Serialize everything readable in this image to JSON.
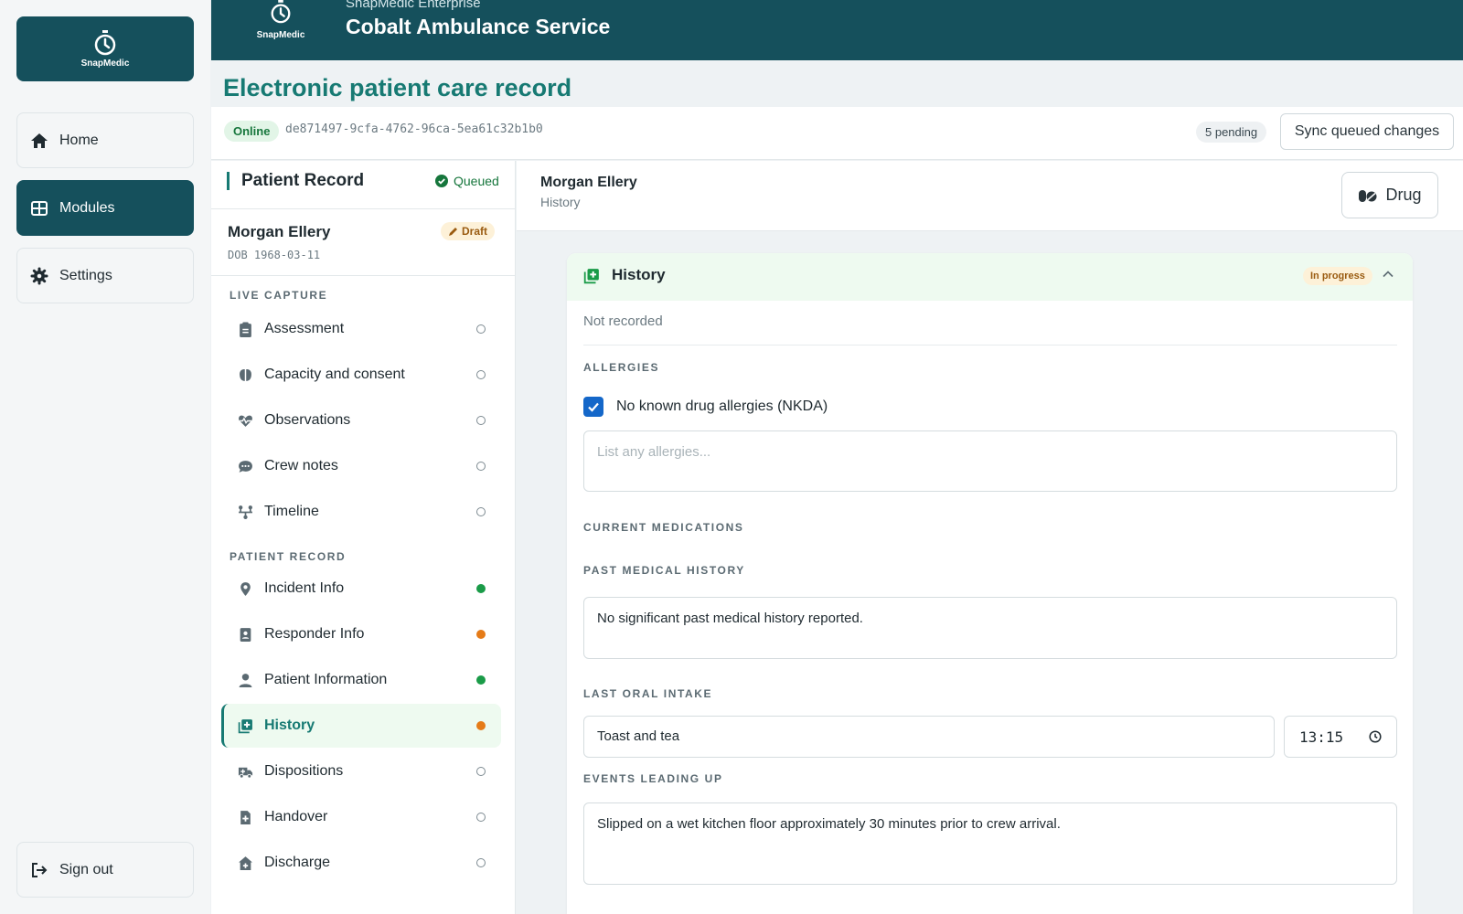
{
  "app": {
    "logo_label": "SnapMedic",
    "enterprise_label": "SnapMedic Enterprise",
    "organization": "Cobalt Ambulance Service"
  },
  "leftnav": {
    "items": [
      {
        "label": "Home",
        "icon": "home-icon"
      },
      {
        "label": "Modules",
        "icon": "grid-icon"
      },
      {
        "label": "Settings",
        "icon": "gear-icon"
      }
    ],
    "signout_label": "Sign out"
  },
  "page": {
    "title": "Electronic patient care record"
  },
  "status": {
    "online": "Online",
    "record_id": "de871497-9cfa-4762-96ca-5ea61c32b1b0",
    "pending": "5 pending",
    "sync_button": "Sync queued changes"
  },
  "patient_panel": {
    "title": "Patient Record",
    "queued_label": "Queued",
    "patient_name": "Morgan Ellery",
    "dob": "DOB 1968-03-11",
    "draft_label": "Draft",
    "live_capture_label": "LIVE CAPTURE",
    "live_capture": [
      {
        "label": "Assessment",
        "icon": "clipboard-icon",
        "status": "empty"
      },
      {
        "label": "Capacity and consent",
        "icon": "brain-icon",
        "status": "empty"
      },
      {
        "label": "Observations",
        "icon": "heart-pulse-icon",
        "status": "empty"
      },
      {
        "label": "Crew notes",
        "icon": "chat-icon",
        "status": "empty"
      },
      {
        "label": "Timeline",
        "icon": "timeline-icon",
        "status": "empty"
      }
    ],
    "patient_record_label": "PATIENT RECORD",
    "patient_record": [
      {
        "label": "Incident Info",
        "icon": "location-pin-icon",
        "status": "complete"
      },
      {
        "label": "Responder Info",
        "icon": "id-badge-icon",
        "status": "in-progress"
      },
      {
        "label": "Patient Information",
        "icon": "person-icon",
        "status": "complete"
      },
      {
        "label": "History",
        "icon": "medical-history-icon",
        "status": "in-progress",
        "active": true
      },
      {
        "label": "Dispositions",
        "icon": "ambulance-icon",
        "status": "empty"
      },
      {
        "label": "Handover",
        "icon": "document-plus-icon",
        "status": "empty"
      },
      {
        "label": "Discharge",
        "icon": "house-medical-icon",
        "status": "empty"
      }
    ]
  },
  "main": {
    "patient_name": "Morgan Ellery",
    "subtitle": "History",
    "drug_button": "Drug"
  },
  "history_card": {
    "title": "History",
    "status_badge": "In progress",
    "not_recorded": "Not recorded",
    "allergies_label": "ALLERGIES",
    "nkda_label": "No known drug allergies (NKDA)",
    "nkda_checked": true,
    "allergies_placeholder": "List any allergies...",
    "current_medications_label": "CURRENT MEDICATIONS",
    "past_medical_history_label": "PAST MEDICAL HISTORY",
    "past_medical_history": "No significant past medical history reported.",
    "last_oral_intake_label": "LAST ORAL INTAKE",
    "last_oral_intake": "Toast and tea",
    "last_oral_intake_time": "13:15",
    "events_leading_up_label": "EVENTS LEADING UP",
    "events_leading_up": "Slipped on a wet kitchen floor approximately 30 minutes prior to crew arrival."
  },
  "colors": {
    "brand": "#15505c",
    "accent": "#177a73",
    "complete": "#1a9b48",
    "in_progress": "#e57b18",
    "checkbox": "#1467c9"
  }
}
